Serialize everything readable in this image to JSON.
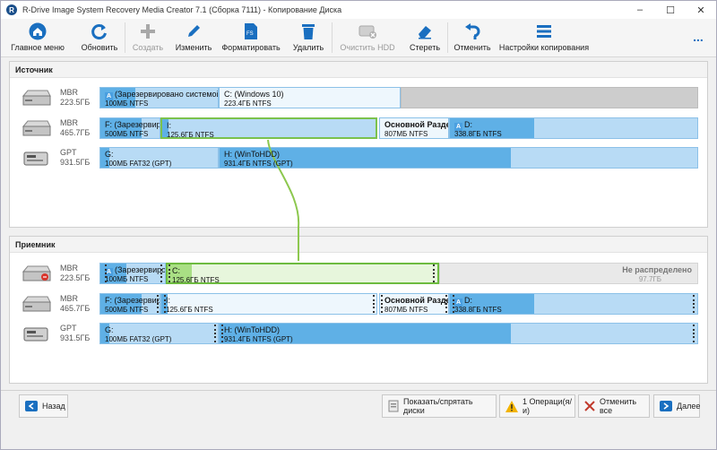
{
  "window": {
    "title": "R-Drive Image System Recovery Media Creator 7.1 (Сборка 7111) - Копирование Диска"
  },
  "toolbar": {
    "items": [
      {
        "label": "Главное меню",
        "icon": "home-icon",
        "enabled": true
      },
      {
        "label": "Обновить",
        "icon": "refresh-icon",
        "enabled": true
      },
      {
        "label": "Создать",
        "icon": "plus-icon",
        "enabled": false
      },
      {
        "label": "Изменить",
        "icon": "pencil-icon",
        "enabled": true
      },
      {
        "label": "Форматировать",
        "icon": "format-icon",
        "enabled": true
      },
      {
        "label": "Удалить",
        "icon": "trash-icon",
        "enabled": true
      },
      {
        "label": "Очистить HDD",
        "icon": "wipe-disk-icon",
        "enabled": false
      },
      {
        "label": "Стереть",
        "icon": "eraser-icon",
        "enabled": true
      },
      {
        "label": "Отменить",
        "icon": "undo-icon",
        "enabled": true
      },
      {
        "label": "Настройки копирования",
        "icon": "hamburger-icon",
        "enabled": true
      }
    ],
    "more": "..."
  },
  "source": {
    "title": "Источник",
    "disks": [
      {
        "type": "MBR",
        "size": "223.5ГБ",
        "partitions": [
          {
            "name": "(Зарезервировано системой)",
            "size": "100МБ NTFS"
          },
          {
            "name": "C: (Windows 10)",
            "size": "223.4ГБ NTFS"
          }
        ]
      },
      {
        "type": "MBR",
        "size": "465.7ГБ",
        "partitions": [
          {
            "name": "F: (Зарезервировано системой)",
            "size": "500МБ NTFS"
          },
          {
            "name": "I:",
            "size": "125.6ГБ NTFS"
          },
          {
            "name": "Основной Раздел",
            "size": "807МБ NTFS"
          },
          {
            "name": "D:",
            "size": "338.8ГБ NTFS"
          }
        ]
      },
      {
        "type": "GPT",
        "size": "931.5ГБ",
        "partitions": [
          {
            "name": "G:",
            "size": "100МБ FAT32 (GPT)"
          },
          {
            "name": "H: (WinToHDD)",
            "size": "931.4ГБ NTFS (GPT)"
          }
        ]
      }
    ]
  },
  "target": {
    "title": "Приемник",
    "disks": [
      {
        "type": "MBR",
        "size": "223.5ГБ",
        "partitions": [
          {
            "name": "(Зарезервировано системой)",
            "size": "100МБ NTFS"
          },
          {
            "name": "C:",
            "size": "125.6ГБ NTFS"
          },
          {
            "name": "Не распределено",
            "size": "97.7ГБ"
          }
        ]
      },
      {
        "type": "MBR",
        "size": "465.7ГБ",
        "partitions": [
          {
            "name": "F: (Зарезервировано системой)",
            "size": "500МБ NTFS"
          },
          {
            "name": "I:",
            "size": "125.6ГБ NTFS"
          },
          {
            "name": "Основной Раздел",
            "size": "807МБ NTFS"
          },
          {
            "name": "D:",
            "size": "338.8ГБ NTFS"
          }
        ]
      },
      {
        "type": "GPT",
        "size": "931.5ГБ",
        "partitions": [
          {
            "name": "G:",
            "size": "100МБ FAT32 (GPT)"
          },
          {
            "name": "H: (WinToHDD)",
            "size": "931.4ГБ NTFS (GPT)"
          }
        ]
      }
    ]
  },
  "bottom": {
    "back": "Назад",
    "toggle_disks": "Показать/спрятать диски",
    "operations": "1 Операци(я/и)",
    "cancel_all": "Отменить все",
    "next": "Далее"
  },
  "colors": {
    "partition_used": "#5fb0e6",
    "partition_free": "#b8dbf5",
    "selection": "#6dbb3f",
    "accent": "#1a6fc0"
  }
}
